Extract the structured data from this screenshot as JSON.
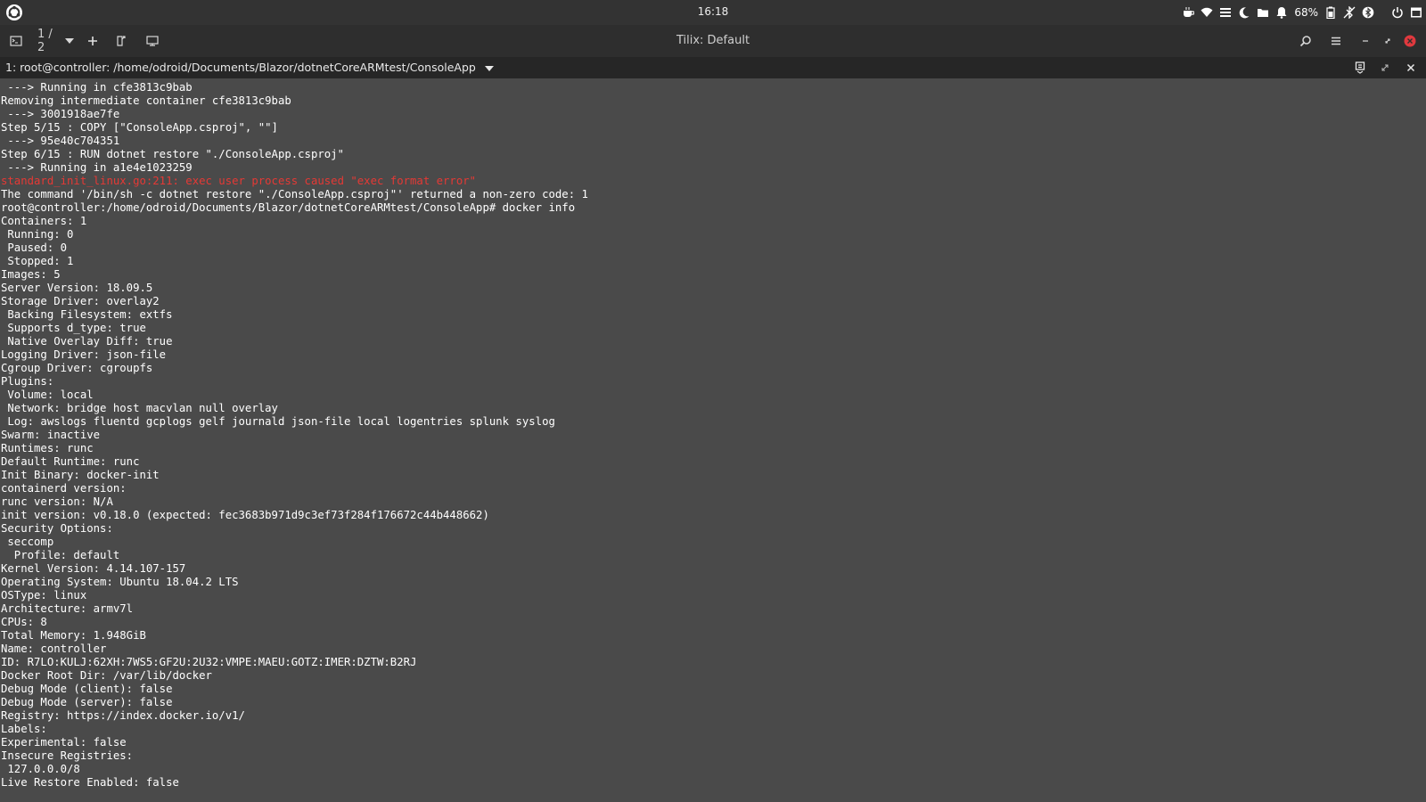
{
  "system_bar": {
    "clock": "16:18",
    "battery_percent": "68%",
    "icons": [
      "ubuntu-logo-icon",
      "coffee-icon",
      "wifi-icon",
      "menu-lines-icon",
      "moon-icon",
      "folder-icon",
      "bell-icon",
      "battery-icon",
      "bluetooth-off-icon",
      "bluetooth-icon",
      "power-icon",
      "window-icon"
    ]
  },
  "header": {
    "window_title": "Tilix: Default",
    "page_indicator": "1 / 2",
    "icons": [
      "sidebar-toggle-icon",
      "dropdown-icon",
      "add-terminal-icon",
      "detach-icon",
      "new-session-icon",
      "search-icon",
      "hamburger-menu-icon",
      "minimize-icon",
      "maximize-icon",
      "close-icon"
    ]
  },
  "terminal_title": {
    "text": "1: root@controller: /home/odroid/Documents/Blazor/dotnetCoreARMtest/ConsoleApp"
  },
  "terminal": {
    "lines": [
      {
        "text": " ---> Running in cfe3813c9bab",
        "error": false
      },
      {
        "text": "Removing intermediate container cfe3813c9bab",
        "error": false
      },
      {
        "text": " ---> 3001918ae7fe",
        "error": false
      },
      {
        "text": "Step 5/15 : COPY [\"ConsoleApp.csproj\", \"\"]",
        "error": false
      },
      {
        "text": " ---> 95e40c704351",
        "error": false
      },
      {
        "text": "Step 6/15 : RUN dotnet restore \"./ConsoleApp.csproj\"",
        "error": false
      },
      {
        "text": " ---> Running in a1e4e1023259",
        "error": false
      },
      {
        "text": "standard_init_linux.go:211: exec user process caused \"exec format error\"",
        "error": true
      },
      {
        "text": "The command '/bin/sh -c dotnet restore \"./ConsoleApp.csproj\"' returned a non-zero code: 1",
        "error": false
      },
      {
        "text": "root@controller:/home/odroid/Documents/Blazor/dotnetCoreARMtest/ConsoleApp# docker info",
        "error": false
      },
      {
        "text": "Containers: 1",
        "error": false
      },
      {
        "text": " Running: 0",
        "error": false
      },
      {
        "text": " Paused: 0",
        "error": false
      },
      {
        "text": " Stopped: 1",
        "error": false
      },
      {
        "text": "Images: 5",
        "error": false
      },
      {
        "text": "Server Version: 18.09.5",
        "error": false
      },
      {
        "text": "Storage Driver: overlay2",
        "error": false
      },
      {
        "text": " Backing Filesystem: extfs",
        "error": false
      },
      {
        "text": " Supports d_type: true",
        "error": false
      },
      {
        "text": " Native Overlay Diff: true",
        "error": false
      },
      {
        "text": "Logging Driver: json-file",
        "error": false
      },
      {
        "text": "Cgroup Driver: cgroupfs",
        "error": false
      },
      {
        "text": "Plugins:",
        "error": false
      },
      {
        "text": " Volume: local",
        "error": false
      },
      {
        "text": " Network: bridge host macvlan null overlay",
        "error": false
      },
      {
        "text": " Log: awslogs fluentd gcplogs gelf journald json-file local logentries splunk syslog",
        "error": false
      },
      {
        "text": "Swarm: inactive",
        "error": false
      },
      {
        "text": "Runtimes: runc",
        "error": false
      },
      {
        "text": "Default Runtime: runc",
        "error": false
      },
      {
        "text": "Init Binary: docker-init",
        "error": false
      },
      {
        "text": "containerd version:",
        "error": false
      },
      {
        "text": "runc version: N/A",
        "error": false
      },
      {
        "text": "init version: v0.18.0 (expected: fec3683b971d9c3ef73f284f176672c44b448662)",
        "error": false
      },
      {
        "text": "Security Options:",
        "error": false
      },
      {
        "text": " seccomp",
        "error": false
      },
      {
        "text": "  Profile: default",
        "error": false
      },
      {
        "text": "Kernel Version: 4.14.107-157",
        "error": false
      },
      {
        "text": "Operating System: Ubuntu 18.04.2 LTS",
        "error": false
      },
      {
        "text": "OSType: linux",
        "error": false
      },
      {
        "text": "Architecture: armv7l",
        "error": false
      },
      {
        "text": "CPUs: 8",
        "error": false
      },
      {
        "text": "Total Memory: 1.948GiB",
        "error": false
      },
      {
        "text": "Name: controller",
        "error": false
      },
      {
        "text": "ID: R7LO:KULJ:62XH:7WS5:GF2U:2U32:VMPE:MAEU:GOTZ:IMER:DZTW:B2RJ",
        "error": false
      },
      {
        "text": "Docker Root Dir: /var/lib/docker",
        "error": false
      },
      {
        "text": "Debug Mode (client): false",
        "error": false
      },
      {
        "text": "Debug Mode (server): false",
        "error": false
      },
      {
        "text": "Registry: https://index.docker.io/v1/",
        "error": false
      },
      {
        "text": "Labels:",
        "error": false
      },
      {
        "text": "Experimental: false",
        "error": false
      },
      {
        "text": "Insecure Registries:",
        "error": false
      },
      {
        "text": " 127.0.0.0/8",
        "error": false
      },
      {
        "text": "Live Restore Enabled: false",
        "error": false
      }
    ]
  },
  "colors": {
    "terminal_bg": "#4a4a4a",
    "terminal_fg": "#ffffff",
    "error_fg": "#e53935",
    "header_bg": "#2e2e2e",
    "system_bar_bg": "#333333",
    "close_button": "#e0393e"
  }
}
